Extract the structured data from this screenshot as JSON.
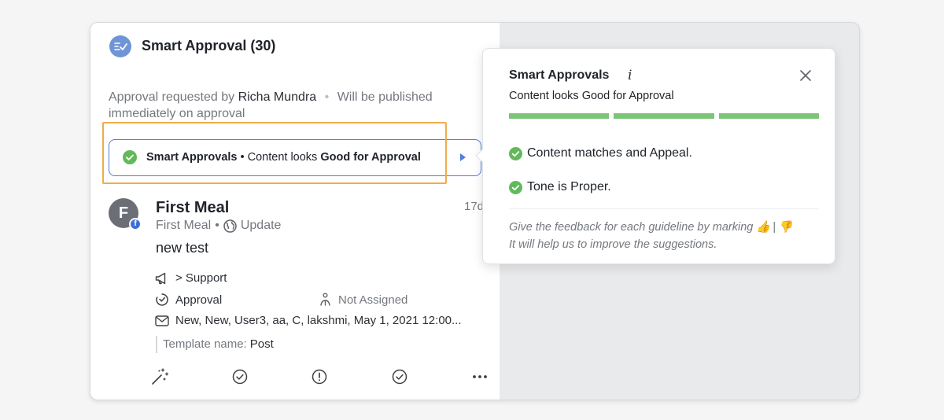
{
  "header": {
    "title": "Smart Approval (30)",
    "icon": "approval-icon"
  },
  "request": {
    "prefix": "Approval requested by",
    "requester": "Richa Mundra",
    "separator": "•",
    "publish_note": "Will be published immediately on approval"
  },
  "smart_pill": {
    "label": "Smart Approvals",
    "separator": "•",
    "text": "Content looks",
    "emphasis": "Good for Approval",
    "status_color": "#62b95b",
    "highlight_color": "#f0ac4c",
    "border_color": "#4e7fe0"
  },
  "post": {
    "avatar_letter": "F",
    "network_badge": "f",
    "title": "First Meal",
    "age": "17d",
    "account": "First Meal",
    "separator": "•",
    "type": "Update",
    "body": "new test",
    "meta": {
      "queue": "> Support",
      "status": "Approval",
      "assignee": "Not Assigned",
      "tags": "New, New, User3, aa, C, lakshmi, May 1, 2021 12:00...",
      "template_label": "Template name:",
      "template_value": "Post"
    }
  },
  "actions": [
    "magic-wand-icon",
    "check-circle-icon",
    "alert-circle-icon",
    "check-circle-icon",
    "more-icon"
  ],
  "popover": {
    "title": "Smart Approvals",
    "info_symbol": "i",
    "subtitle": "Content looks Good for Approval",
    "progress_segments_filled": 3,
    "progress_segments_total": 3,
    "progress_color": "#7cc576",
    "checks": [
      {
        "label": "Content matches and Appeal."
      },
      {
        "label": "Tone is Proper."
      }
    ],
    "feedback_line1": "Give the feedback for each guideline by marking",
    "thumbs_up": "👍",
    "feedback_sep": "|",
    "thumbs_down": "👎",
    "feedback_line2": "It will help us to improve the suggestions."
  }
}
